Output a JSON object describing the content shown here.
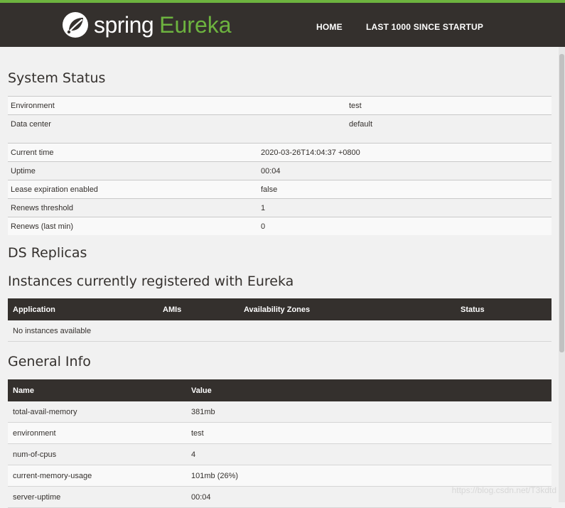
{
  "brand": {
    "word1": "spring",
    "word2": "Eureka"
  },
  "nav": {
    "home": "HOME",
    "last1000": "LAST 1000 SINCE STARTUP"
  },
  "system_status": {
    "title": "System Status",
    "env_table": [
      {
        "key": "Environment",
        "value": "test"
      },
      {
        "key": "Data center",
        "value": "default"
      }
    ],
    "status_table": [
      {
        "key": "Current time",
        "value": "2020-03-26T14:04:37 +0800"
      },
      {
        "key": "Uptime",
        "value": "00:04"
      },
      {
        "key": "Lease expiration enabled",
        "value": "false"
      },
      {
        "key": "Renews threshold",
        "value": "1"
      },
      {
        "key": "Renews (last min)",
        "value": "0"
      }
    ]
  },
  "ds_replicas": {
    "title": "DS Replicas"
  },
  "instances": {
    "title": "Instances currently registered with Eureka",
    "columns": [
      "Application",
      "AMIs",
      "Availability Zones",
      "Status"
    ],
    "empty_message": "No instances available"
  },
  "general_info": {
    "title": "General Info",
    "columns": [
      "Name",
      "Value"
    ],
    "rows": [
      {
        "name": "total-avail-memory",
        "value": "381mb"
      },
      {
        "name": "environment",
        "value": "test"
      },
      {
        "name": "num-of-cpus",
        "value": "4"
      },
      {
        "name": "current-memory-usage",
        "value": "101mb (26%)"
      },
      {
        "name": "server-uptime",
        "value": "00:04"
      }
    ]
  },
  "watermark": "https://blog.csdn.net/T3kdtd",
  "colors": {
    "header_bg": "#34302d",
    "accent": "#6db33f"
  }
}
